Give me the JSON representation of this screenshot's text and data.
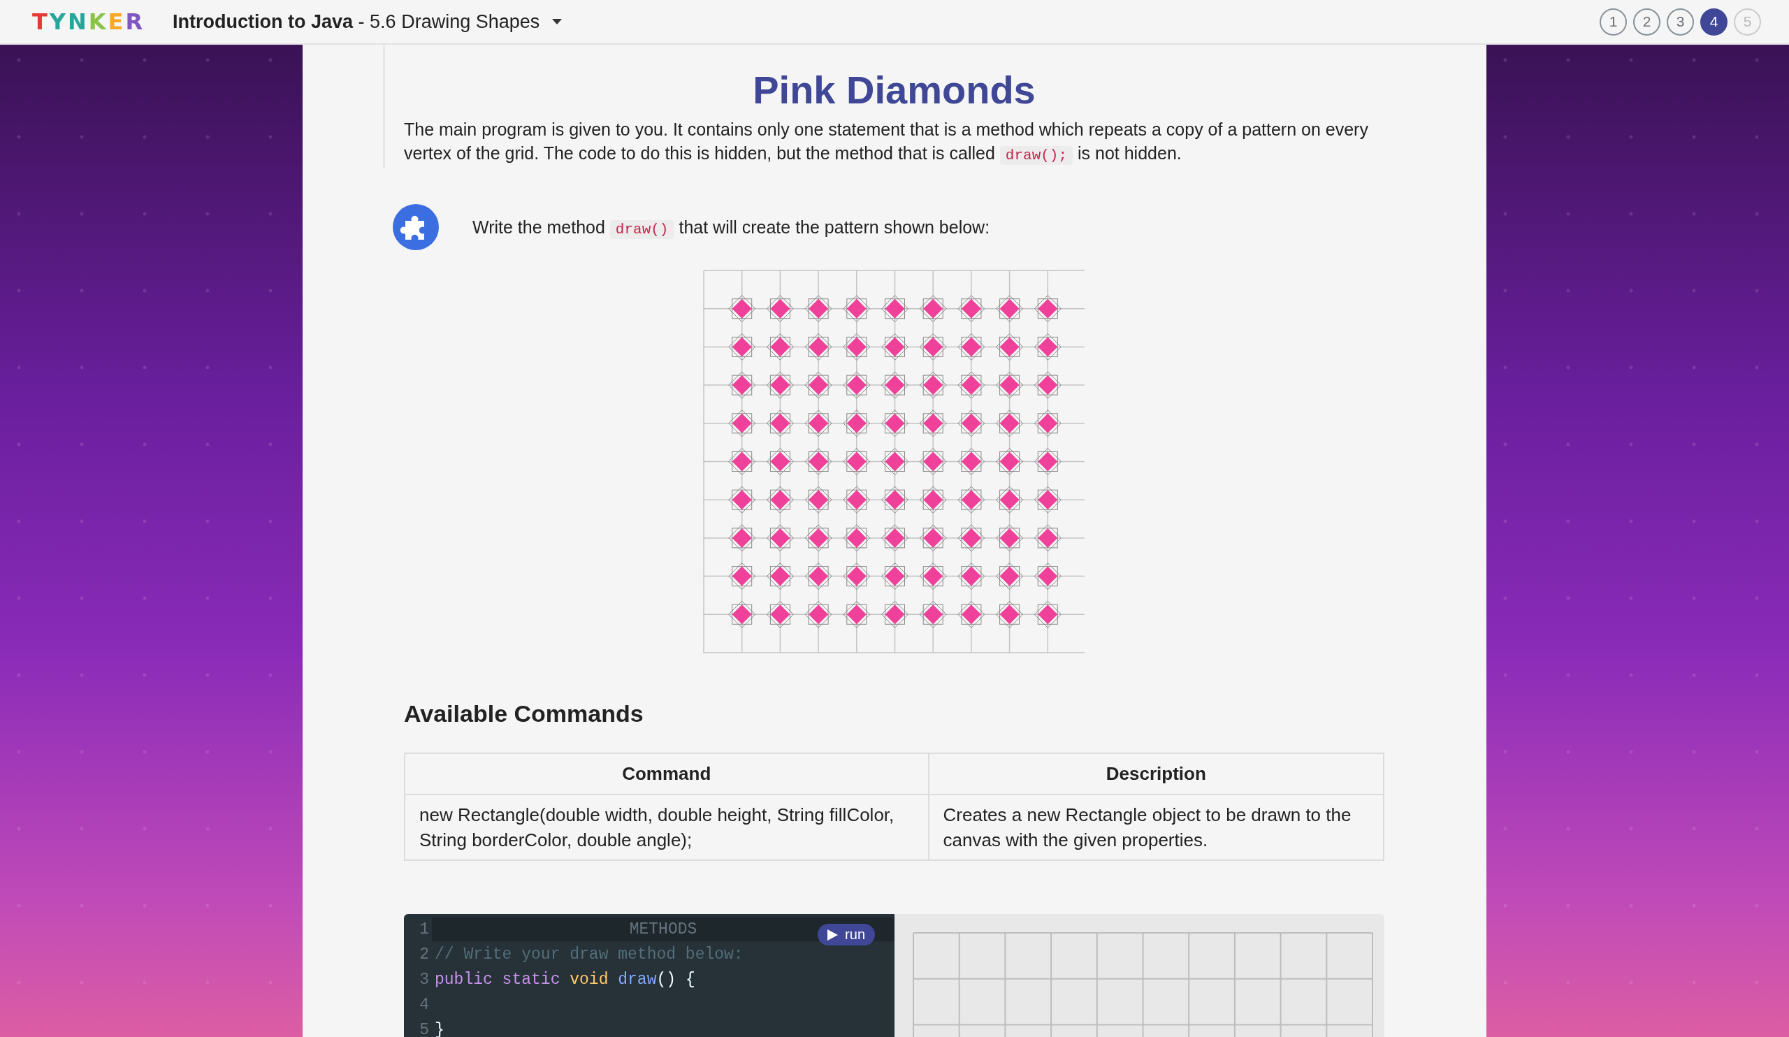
{
  "header": {
    "logo": "TYNKER",
    "course_title": "**Introduction to Java** - 5.6 Drawing Shapes",
    "steps": [
      {
        "label": "1",
        "selected": false,
        "disabled": false
      },
      {
        "label": "2",
        "selected": false,
        "disabled": false
      },
      {
        "label": "3",
        "selected": false,
        "disabled": false
      },
      {
        "label": "4",
        "selected": true,
        "disabled": false
      },
      {
        "label": "5",
        "selected": false,
        "disabled": true
      }
    ]
  },
  "lesson": {
    "title": "Pink Diamonds",
    "intro": [
      {
        "kind": "text",
        "text": "The main program is given to you. It contains only one statement that is a method which repeats a copy of a pattern on every vertex of the grid. The code to do this is hidden, but the method that is called "
      },
      {
        "kind": "code",
        "text": "draw();"
      },
      {
        "kind": "text",
        "text": " is not hidden."
      }
    ],
    "task": [
      {
        "kind": "text",
        "text": "Write the method "
      },
      {
        "kind": "code",
        "text": "draw()"
      },
      {
        "kind": "text",
        "text": " that will create the pattern shown below:"
      }
    ]
  },
  "commands": {
    "heading": "Available Commands",
    "columns": [
      "Command",
      "Description"
    ],
    "rows": [
      [
        "new Rectangle(double width, double height, String fillColor, String borderColor, double angle);",
        "Creates a new Rectangle object to be drawn to the canvas with the given properties."
      ]
    ]
  },
  "editor": {
    "section_label": "METHODS",
    "run_button": "run",
    "lines": [
      {
        "number": "1"
      },
      {
        "number": "2",
        "tokens": [
          {
            "kind": "comment",
            "text": "// Write your draw method below:"
          }
        ]
      },
      {
        "number": "3",
        "tokens": [
          {
            "kind": "keyword",
            "text": "public static "
          },
          {
            "kind": "type",
            "text": "void "
          },
          {
            "kind": "function",
            "text": "draw"
          },
          {
            "kind": "plain",
            "text": "() {"
          }
        ]
      },
      {
        "number": "4"
      },
      {
        "number": "5",
        "tokens": [
          {
            "kind": "plain",
            "text": "}"
          }
        ]
      }
    ]
  }
}
